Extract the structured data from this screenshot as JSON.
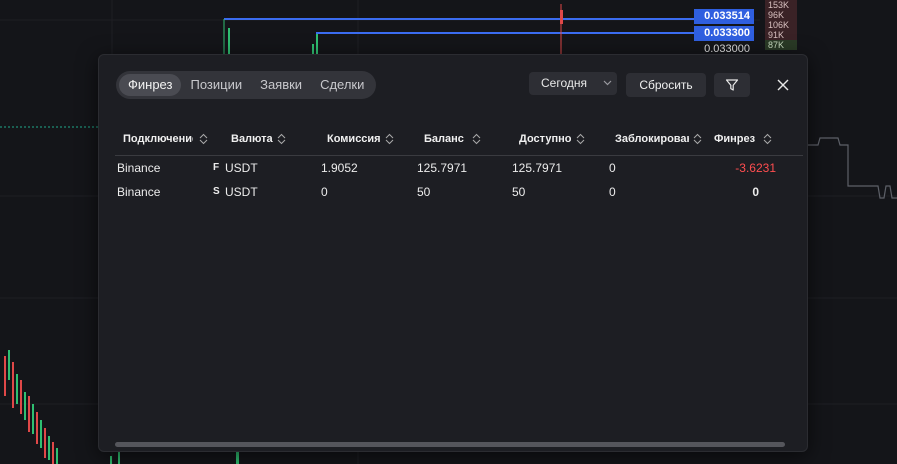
{
  "chart_bg": {
    "prices": [
      {
        "label": "0.033514",
        "highlight": true
      },
      {
        "label": "0.033300",
        "highlight": true
      },
      {
        "label": "0.033000",
        "highlight": false
      }
    ],
    "volumes": [
      "153K",
      "96K",
      "106K",
      "91K",
      "87K"
    ]
  },
  "modal": {
    "tabs": [
      {
        "label": "Финрез",
        "active": true
      },
      {
        "label": "Позиции",
        "active": false
      },
      {
        "label": "Заявки",
        "active": false
      },
      {
        "label": "Сделки",
        "active": false
      }
    ],
    "date_filter": {
      "value": "Сегодня"
    },
    "reset_label": "Сбросить",
    "columns": [
      "Подключение",
      "Валюта",
      "Комиссия",
      "Баланс",
      "Доступно",
      "Заблокировано",
      "Финрез"
    ],
    "rows": [
      {
        "connection": "Binance",
        "market": "F",
        "currency": "USDT",
        "commission": "1.9052",
        "balance": "125.7971",
        "available": "125.7971",
        "blocked": "0",
        "pnl": "-3.6231"
      },
      {
        "connection": "Binance",
        "market": "S",
        "currency": "USDT",
        "commission": "0",
        "balance": "50",
        "available": "50",
        "blocked": "0",
        "pnl": "0"
      }
    ]
  },
  "colors": {
    "accent": "#2f5fe0",
    "negative": "#ff4d4f",
    "background": "#141519",
    "panel": "#1d1e23"
  }
}
